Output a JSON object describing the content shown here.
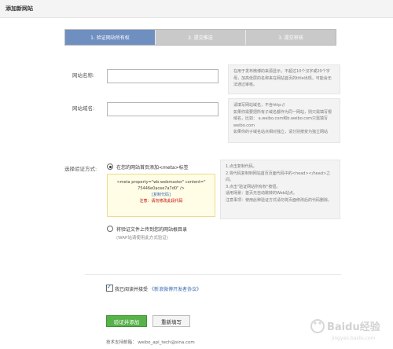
{
  "header": {
    "title": "添加新网站"
  },
  "steps": [
    {
      "label": "1. 验证网站所有权",
      "active": true
    },
    {
      "label": "2. 提交推送"
    },
    {
      "label": "3. 提交审核"
    }
  ],
  "form": {
    "site_name_label": "网站名称:",
    "site_name_value": "",
    "site_name_hint": "在用于发布微博的来源显示，不超过10个汉字或20个字母，加高低层的名称来在网站首页的title出现，可能会无法通过审核。",
    "domain_label": "网站域名:",
    "domain_value": "",
    "domain_hint_1": "请填写网站域名，不含http://",
    "domain_hint_2": "如果你需要把所有子域名都作为同一网站，则只需填写根域名，比如： a.weibo.com和b.weibo.com只需填写weibo.com",
    "domain_hint_3": "如果你的子域名站点相对独立，请分别按变为独立网站",
    "verify_label": "选择验证方式:",
    "option1_text": "在您的网站首页添加<meta>标签",
    "meta_line1": "<meta property=\"wb:webmaster\" content=\"",
    "meta_line2": "75446e0acee7a7d0\" />",
    "copy_link": "[复制代码]",
    "warn_text": "注意：请勿修改此段代码",
    "option1_hint": "1.点击复制代码。\n2.将代码复制到网站首页页面代码中的<head></head>之间。\n3.点击\"验证网站所有权\"按钮。\n适用场景：首页无自动跳转的Web站点。\n注意事项：使用此种验证方式请勿将页面修改后的代码删除。",
    "option2_text": "将验证文件上传到您的网站根目录",
    "option2_note": "(WAP站请使用此方式验证)"
  },
  "agreement": {
    "text": "我已阅读并接受",
    "link": "《新浪微博开发者协议》",
    "checked": true
  },
  "buttons": {
    "primary": "验证并添加",
    "secondary": "重新填写"
  },
  "support": {
    "label": "技术支持邮箱：",
    "email": "weibo_api_tech@sina.com"
  },
  "watermark": {
    "text": "Baidu经验",
    "subtext": "jingyan.baidu.com"
  }
}
